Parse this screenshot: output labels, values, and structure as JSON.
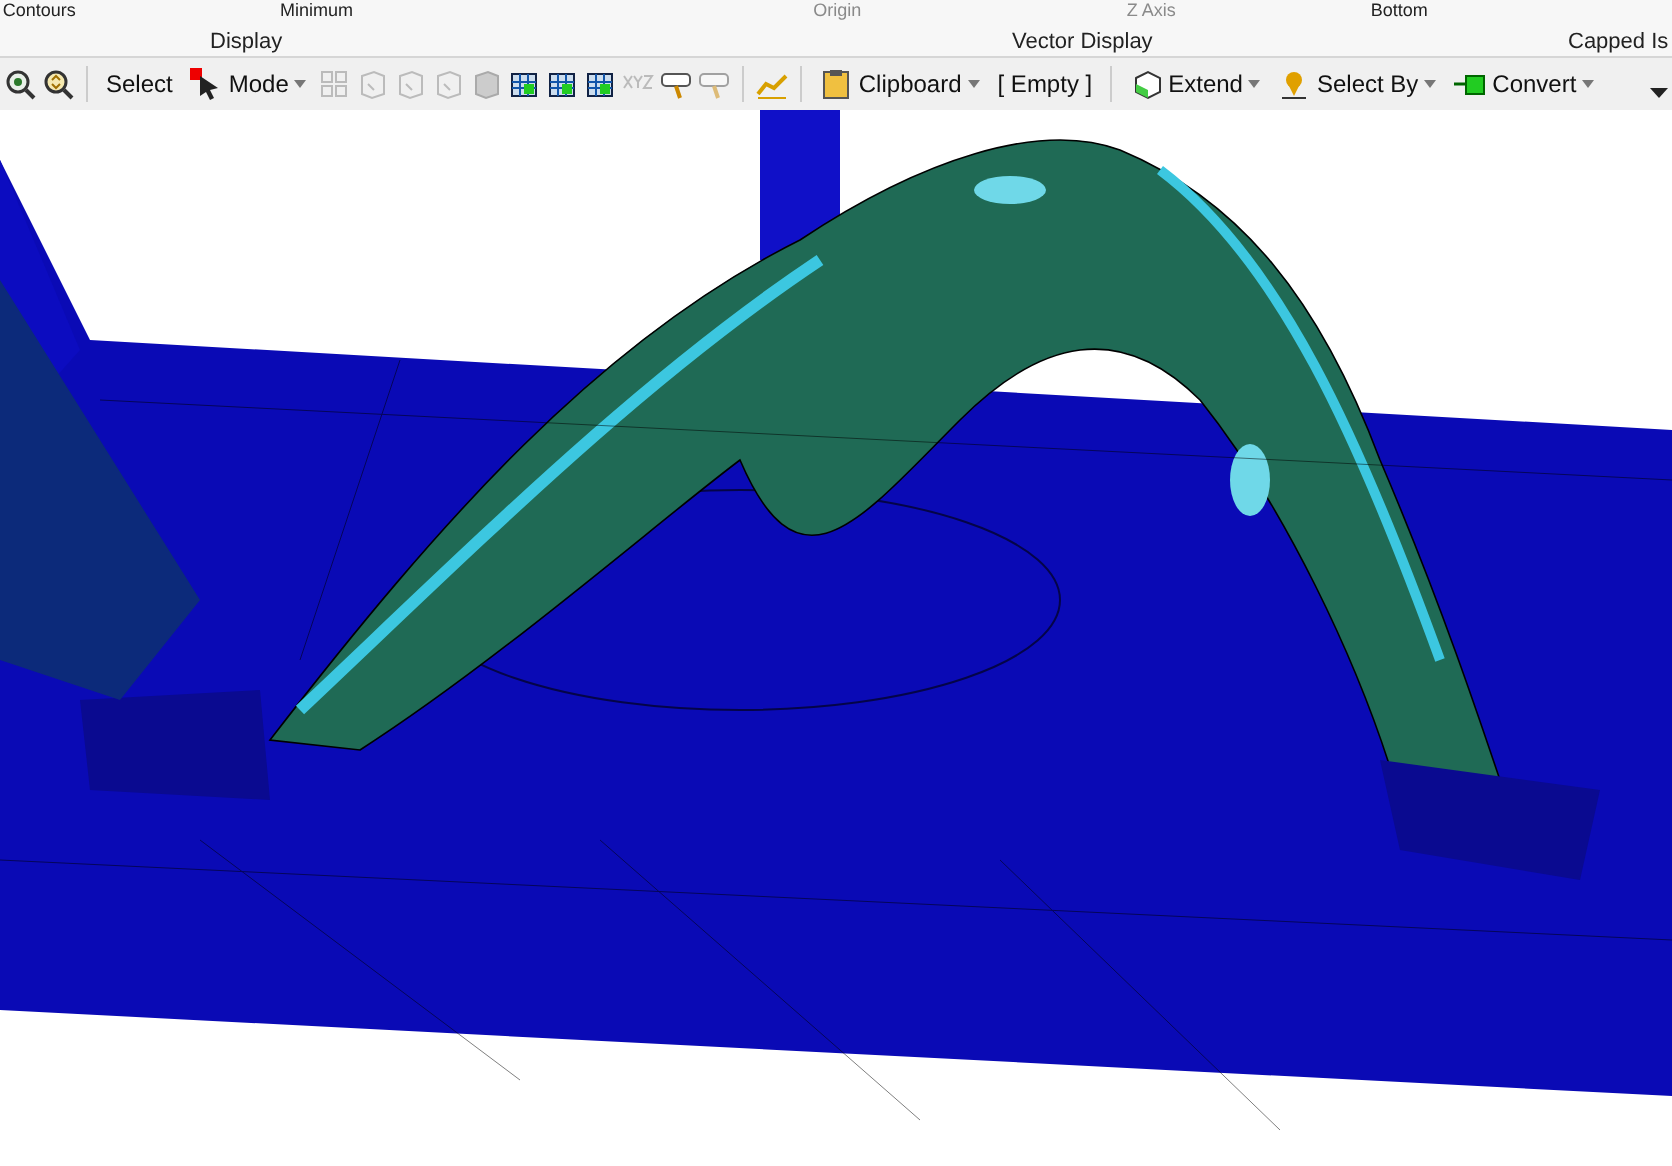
{
  "ribbon": {
    "top_labels": [
      {
        "text": "Contours",
        "disabled": false
      },
      {
        "text": "Minimum",
        "disabled": false
      },
      {
        "text": "Origin",
        "disabled": true
      },
      {
        "text": "Z Axis",
        "disabled": true
      },
      {
        "text": "Bottom",
        "disabled": false
      }
    ],
    "groups": [
      "Display",
      "Vector Display",
      "Capped Is"
    ]
  },
  "toolbar": {
    "items": [
      {
        "kind": "icon"
      },
      {
        "kind": "icon"
      },
      {
        "kind": "sep"
      },
      {
        "kind": "text",
        "label": "Select"
      },
      {
        "kind": "dropdown",
        "label": "Mode"
      },
      {
        "kind": "icon",
        "disabled": true
      },
      {
        "kind": "icon",
        "disabled": true
      },
      {
        "kind": "icon",
        "disabled": true
      },
      {
        "kind": "icon",
        "disabled": true
      },
      {
        "kind": "icon",
        "disabled": true
      },
      {
        "kind": "icon",
        "disabled": false
      },
      {
        "kind": "icon",
        "disabled": false
      },
      {
        "kind": "icon",
        "disabled": false
      },
      {
        "kind": "icon",
        "disabled": true
      },
      {
        "kind": "icon",
        "disabled": false
      },
      {
        "kind": "icon",
        "disabled": true
      },
      {
        "kind": "sep"
      },
      {
        "kind": "icon",
        "disabled": false
      },
      {
        "kind": "sep"
      },
      {
        "kind": "dropdown",
        "label": "Clipboard"
      },
      {
        "kind": "text",
        "label": "[ Empty ]"
      },
      {
        "kind": "sep"
      },
      {
        "kind": "dropdown",
        "label": "Extend"
      },
      {
        "kind": "dropdown",
        "label": "Select By"
      },
      {
        "kind": "dropdown",
        "label": "Convert"
      },
      {
        "kind": "overflow"
      }
    ]
  }
}
